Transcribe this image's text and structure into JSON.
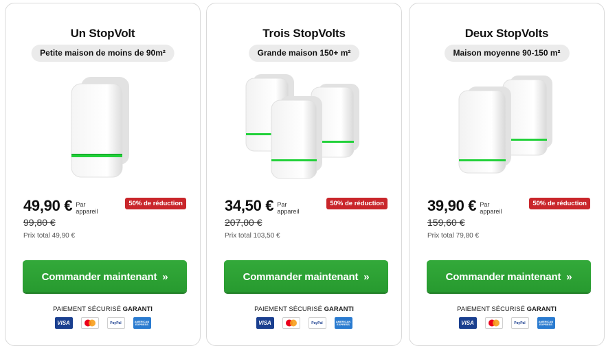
{
  "cards": [
    {
      "title": "Un StopVolt",
      "subtitle": "Petite maison de moins de 90m²",
      "price": "49,90 €",
      "per_unit": "Par appareil",
      "discount_badge": "50% de réduction",
      "old_price": "99,80 €",
      "total": "Prix total 49,90 €",
      "cta_label": "Commander maintenant",
      "cta_chevron": "»",
      "secure_prefix": "PAIEMENT SÉCURISÉ",
      "secure_strong": "GARANTI",
      "device_count": 1
    },
    {
      "title": "Trois StopVolts",
      "subtitle": "Grande maison 150+ m²",
      "price": "34,50 €",
      "per_unit": "Par appareil",
      "discount_badge": "50% de réduction",
      "old_price": "207,00 €",
      "total": "Prix total 103,50 €",
      "cta_label": "Commander maintenant",
      "cta_chevron": "»",
      "secure_prefix": "PAIEMENT SÉCURISÉ",
      "secure_strong": "GARANTI",
      "device_count": 3
    },
    {
      "title": "Deux StopVolts",
      "subtitle": "Maison moyenne 90-150 m²",
      "price": "39,90 €",
      "per_unit": "Par appareil",
      "discount_badge": "50% de réduction",
      "old_price": "159,60 €",
      "total": "Prix total 79,80 €",
      "cta_label": "Commander maintenant",
      "cta_chevron": "»",
      "secure_prefix": "PAIEMENT SÉCURISÉ",
      "secure_strong": "GARANTI",
      "device_count": 2
    }
  ],
  "payment_icons": [
    {
      "icon": "visa-icon",
      "label": "VISA"
    },
    {
      "icon": "mastercard-icon",
      "label": ""
    },
    {
      "icon": "paypal-icon",
      "label": "PayPal"
    },
    {
      "icon": "amex-icon",
      "label": "AMERICAN EXPRESS"
    }
  ],
  "colors": {
    "cta_green": "#2ba133",
    "badge_red": "#c9262b",
    "led_green": "#22d13a",
    "pill_gray": "#ebebeb"
  }
}
